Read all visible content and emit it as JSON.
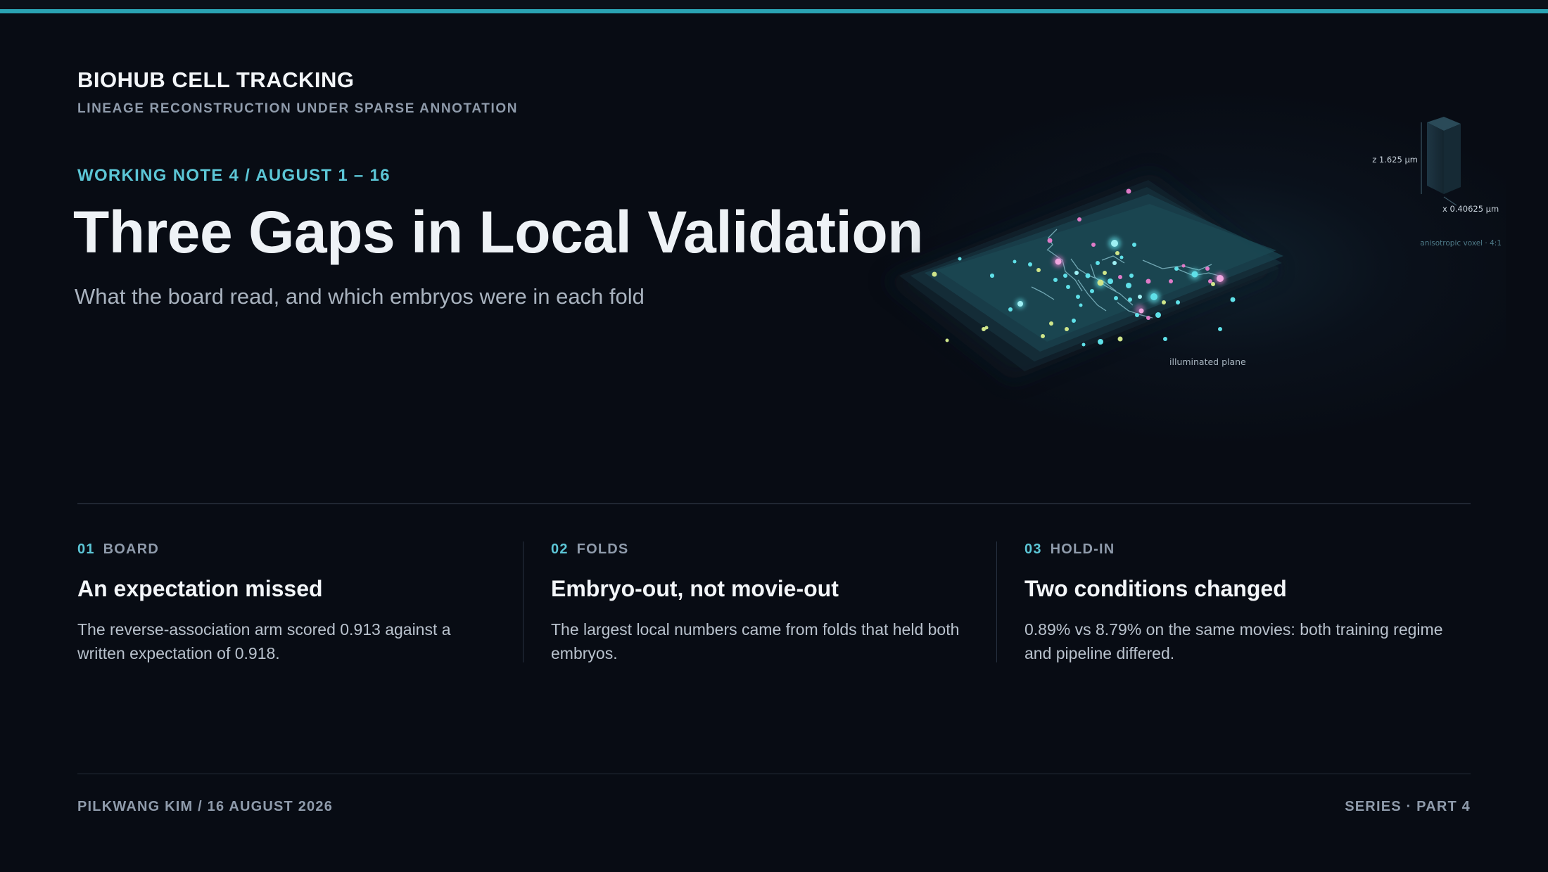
{
  "header": {
    "brand": "BIOHUB CELL TRACKING",
    "brand_sub": "LINEAGE RECONSTRUCTION UNDER SPARSE ANNOTATION"
  },
  "hero": {
    "eyebrow": "WORKING NOTE 4 / AUGUST 1 – 16",
    "title": "Three Gaps in Local Validation",
    "subtitle": "What the board read, and which embryos were in each fold"
  },
  "illustration": {
    "z_label": "z 1.625 µm",
    "x_label": "x 0.40625 µm",
    "voxel_label": "anisotropic voxel · 4:1",
    "plane_label": "illuminated plane",
    "colors": {
      "cyan": "#5fe0e8",
      "pink": "#e07bc8",
      "lime": "#cfe58a"
    }
  },
  "columns": [
    {
      "num": "01",
      "label": "BOARD",
      "title": "An expectation missed",
      "text": "The reverse-association arm scored 0.913 against a written expectation of 0.918."
    },
    {
      "num": "02",
      "label": "FOLDS",
      "title": "Embryo-out, not movie-out",
      "text": "The largest local numbers came from folds that held both embryos."
    },
    {
      "num": "03",
      "label": "HOLD-IN",
      "title": "Two conditions changed",
      "text": "0.89% vs 8.79% on the same movies: both training regime and pipeline differed."
    }
  ],
  "footer": {
    "left": "PILKWANG KIM / 16 AUGUST 2026",
    "right": "SERIES · PART 4"
  },
  "colors": {
    "accent": "#5cc6d6",
    "background": "#080c14",
    "topbar": "#2aa3b3"
  }
}
